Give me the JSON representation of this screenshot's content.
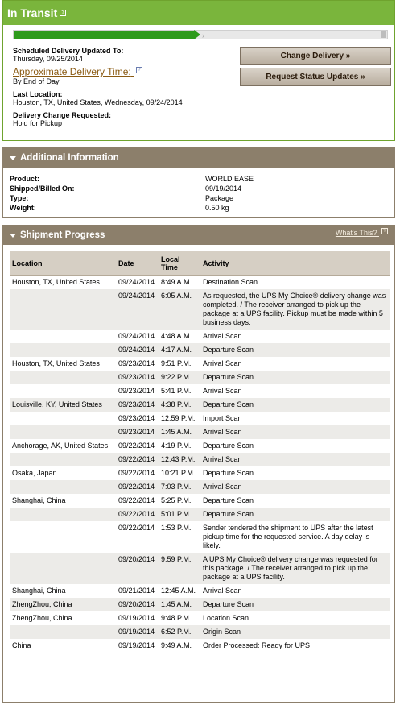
{
  "transit": {
    "title": "In Transit",
    "progress_fraction": 0.5,
    "scheduled_label": "Scheduled Delivery Updated To:",
    "scheduled_value": "Thursday, 09/25/2014",
    "approx_label": "Approximate Delivery Time:",
    "approx_value": "By End of Day",
    "last_location_label": "Last Location:",
    "last_location_value": "Houston, TX, United States, Wednesday, 09/24/2014",
    "change_label": "Delivery Change Requested:",
    "change_value": "Hold for Pickup",
    "buttons": {
      "change_delivery": "Change Delivery »",
      "request_updates": "Request Status Updates »"
    }
  },
  "additional": {
    "title": "Additional Information",
    "rows": [
      {
        "k": "Product:",
        "v": "WORLD EASE"
      },
      {
        "k": "Shipped/Billed On:",
        "v": "09/19/2014"
      },
      {
        "k": "Type:",
        "v": "Package"
      },
      {
        "k": "Weight:",
        "v": "0.50 kg"
      }
    ]
  },
  "progress": {
    "title": "Shipment Progress",
    "whats_this": "What's This?",
    "headers": [
      "Location",
      "Date",
      "Local Time",
      "Activity"
    ],
    "rows": [
      [
        "Houston, TX, United States",
        "09/24/2014",
        "8:49 A.M.",
        "Destination Scan"
      ],
      [
        "",
        "09/24/2014",
        "6:05 A.M.",
        "As requested, the UPS My Choice® delivery change was completed. / The receiver arranged to pick up the package at a UPS facility. Pickup must be made within 5 business days."
      ],
      [
        "",
        "09/24/2014",
        "4:48 A.M.",
        "Arrival Scan"
      ],
      [
        "",
        "09/24/2014",
        "4:17 A.M.",
        "Departure Scan"
      ],
      [
        "Houston, TX, United States",
        "09/23/2014",
        "9:51 P.M.",
        "Arrival Scan"
      ],
      [
        "",
        "09/23/2014",
        "9:22 P.M.",
        "Departure Scan"
      ],
      [
        "",
        "09/23/2014",
        "5:41 P.M.",
        "Arrival Scan"
      ],
      [
        "Louisville, KY, United States",
        "09/23/2014",
        "4:38 P.M.",
        "Departure Scan"
      ],
      [
        "",
        "09/23/2014",
        "12:59 P.M.",
        "Import Scan"
      ],
      [
        "",
        "09/23/2014",
        "1:45 A.M.",
        "Arrival Scan"
      ],
      [
        "Anchorage, AK, United States",
        "09/22/2014",
        "4:19 P.M.",
        "Departure Scan"
      ],
      [
        "",
        "09/22/2014",
        "12:43 P.M.",
        "Arrival Scan"
      ],
      [
        "Osaka, Japan",
        "09/22/2014",
        "10:21 P.M.",
        "Departure Scan"
      ],
      [
        "",
        "09/22/2014",
        "7:03 P.M.",
        "Arrival Scan"
      ],
      [
        "Shanghai, China",
        "09/22/2014",
        "5:25 P.M.",
        "Departure Scan"
      ],
      [
        "",
        "09/22/2014",
        "5:01 P.M.",
        "Departure Scan"
      ],
      [
        "",
        "09/22/2014",
        "1:53 P.M.",
        "Sender tendered the shipment to UPS after the latest pickup time for the requested service. A day delay is likely."
      ],
      [
        "",
        "09/20/2014",
        "9:59 P.M.",
        "A UPS My Choice® delivery change was requested for this package. / The receiver arranged to pick up the package at a UPS facility."
      ],
      [
        "Shanghai, China",
        "09/21/2014",
        "12:45 A.M.",
        "Arrival Scan"
      ],
      [
        "ZhengZhou, China",
        "09/20/2014",
        "1:45 A.M.",
        "Departure Scan"
      ],
      [
        "ZhengZhou, China",
        "09/19/2014",
        "9:48 P.M.",
        "Location Scan"
      ],
      [
        "",
        "09/19/2014",
        "6:52 P.M.",
        "Origin Scan"
      ],
      [
        "China",
        "09/19/2014",
        "9:49 A.M.",
        "Order Processed: Ready for UPS"
      ]
    ]
  }
}
